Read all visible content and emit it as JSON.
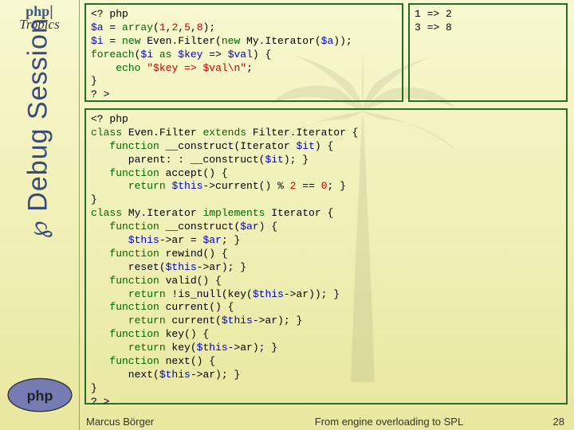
{
  "logo": {
    "php": "php",
    "bar": "|",
    "tropics": "Tropics"
  },
  "sidebar_title": "Debug Session",
  "sidebar_symbol": "℘",
  "code_block1": {
    "l1a": "<? php",
    "l2a": "$a",
    "l2b": " = ",
    "l2c": "array",
    "l2d": "(",
    "l2e": "1",
    "l2f": ",",
    "l2g": "2",
    "l2h": ",",
    "l2i": "5",
    "l2j": ",",
    "l2k": "8",
    "l2l": ");",
    "l3a": "$i",
    "l3b": " = ",
    "l3c": "new",
    "l3d": " Even.Filter(",
    "l3e": "new",
    "l3f": " My.Iterator(",
    "l3g": "$a",
    "l3h": "));",
    "l4a": "foreach",
    "l4b": "(",
    "l4c": "$i",
    "l4d": " ",
    "l4e": "as",
    "l4f": " ",
    "l4g": "$key",
    "l4h": " => ",
    "l4i": "$val",
    "l4j": ") {",
    "l5a": "    ",
    "l5b": "echo",
    "l5c": " ",
    "l5d": "\"$key => $val\\n\"",
    "l5e": ";",
    "l6a": "}",
    "l7a": "? >"
  },
  "output_block": "1 => 2\n3 => 8",
  "code_block2": {
    "l1": "<? php",
    "l2a": "class",
    "l2b": " Even.Filter ",
    "l2c": "extends",
    "l2d": " Filter.Iterator {",
    "l3a": "   ",
    "l3b": "function",
    "l3c": " __construct(Iterator ",
    "l3d": "$it",
    "l3e": ") {",
    "l4a": "      parent: : __construct(",
    "l4b": "$it",
    "l4c": "); }",
    "l5a": "   ",
    "l5b": "function",
    "l5c": " accept() {",
    "l6a": "      ",
    "l6b": "return",
    "l6c": " ",
    "l6d": "$this",
    "l6e": "->current() % ",
    "l6f": "2",
    "l6g": " == ",
    "l6h": "0",
    "l6i": "; }",
    "l7": "}",
    "l8a": "class",
    "l8b": " My.Iterator ",
    "l8c": "implements",
    "l8d": " Iterator {",
    "l9a": "   ",
    "l9b": "function",
    "l9c": " __construct(",
    "l9d": "$ar",
    "l9e": ") {",
    "l10a": "      ",
    "l10b": "$this",
    "l10c": "->ar = ",
    "l10d": "$ar",
    "l10e": "; }",
    "l11a": "   ",
    "l11b": "function",
    "l11c": " rewind() {",
    "l12a": "      reset(",
    "l12b": "$this",
    "l12c": "->ar); }",
    "l13a": "   ",
    "l13b": "function",
    "l13c": " valid() {",
    "l14a": "      ",
    "l14b": "return",
    "l14c": " !is_null(key(",
    "l14d": "$this",
    "l14e": "->ar)); }",
    "l15a": "   ",
    "l15b": "function",
    "l15c": " current() {",
    "l16a": "      ",
    "l16b": "return",
    "l16c": " current(",
    "l16d": "$this",
    "l16e": "->ar); }",
    "l17a": "   ",
    "l17b": "function",
    "l17c": " key() {",
    "l18a": "      ",
    "l18b": "return",
    "l18c": " key(",
    "l18d": "$this",
    "l18e": "->ar); }",
    "l19a": "   ",
    "l19b": "function",
    "l19c": " next() {",
    "l20a": "      next(",
    "l20b": "$this",
    "l20c": "->ar); }",
    "l21": "}",
    "l22": "? >"
  },
  "footer": {
    "author": "Marcus Börger",
    "title": "From engine overloading to SPL",
    "page": "28"
  }
}
